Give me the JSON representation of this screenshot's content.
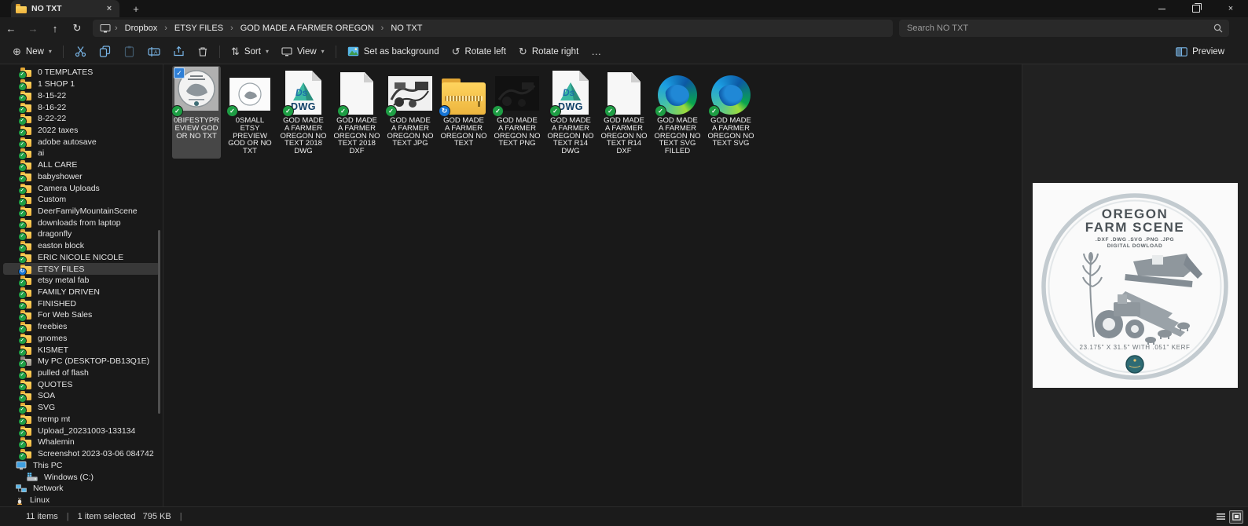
{
  "window": {
    "tab_title": "NO TXT"
  },
  "address": {
    "breadcrumbs": [
      "Dropbox",
      "ETSY FILES",
      "GOD MADE A FARMER OREGON",
      "NO TXT"
    ],
    "search_placeholder": "Search NO TXT"
  },
  "toolbar": {
    "new": "New",
    "sort": "Sort",
    "view": "View",
    "set_as_background": "Set as background",
    "rotate_left": "Rotate left",
    "rotate_right": "Rotate right",
    "more": "…",
    "preview": "Preview"
  },
  "icons": {
    "dwg_label": "DWG"
  },
  "sidebar": {
    "items": [
      {
        "label": "0 TEMPLATES",
        "icon": "dropbox"
      },
      {
        "label": "1 SHOP 1",
        "icon": "dropbox"
      },
      {
        "label": "8-15-22",
        "icon": "dropbox"
      },
      {
        "label": "8-16-22",
        "icon": "dropbox"
      },
      {
        "label": "8-22-22",
        "icon": "dropbox"
      },
      {
        "label": "2022 taxes",
        "icon": "dropbox"
      },
      {
        "label": "adobe autosave",
        "icon": "dropbox"
      },
      {
        "label": "ai",
        "icon": "dropbox"
      },
      {
        "label": "ALL CARE",
        "icon": "dropbox"
      },
      {
        "label": "babyshower",
        "icon": "dropbox"
      },
      {
        "label": "Camera Uploads",
        "icon": "dropbox"
      },
      {
        "label": "Custom",
        "icon": "dropbox"
      },
      {
        "label": "DeerFamilyMountainScene",
        "icon": "dropbox"
      },
      {
        "label": "downloads from laptop",
        "icon": "dropbox"
      },
      {
        "label": "dragonfly",
        "icon": "dropbox"
      },
      {
        "label": "easton block",
        "icon": "dropbox"
      },
      {
        "label": "ERIC NICOLE NICOLE",
        "icon": "dropbox"
      },
      {
        "label": "ETSY FILES",
        "icon": "dropbox-sync",
        "selected": true
      },
      {
        "label": "etsy metal fab",
        "icon": "dropbox"
      },
      {
        "label": "FAMILY DRIVEN",
        "icon": "dropbox"
      },
      {
        "label": "FINISHED",
        "icon": "dropbox"
      },
      {
        "label": "For Web Sales",
        "icon": "dropbox"
      },
      {
        "label": "freebies",
        "icon": "dropbox"
      },
      {
        "label": "gnomes",
        "icon": "dropbox"
      },
      {
        "label": "KISMET",
        "icon": "dropbox"
      },
      {
        "label": "My PC (DESKTOP-DB13Q1E)",
        "icon": "folder-gray"
      },
      {
        "label": "pulled of flash",
        "icon": "dropbox"
      },
      {
        "label": "QUOTES",
        "icon": "dropbox"
      },
      {
        "label": "SOA",
        "icon": "dropbox"
      },
      {
        "label": "SVG",
        "icon": "dropbox"
      },
      {
        "label": "tremp mt",
        "icon": "dropbox"
      },
      {
        "label": "Upload_20231003-133134",
        "icon": "dropbox"
      },
      {
        "label": "Whalemin",
        "icon": "dropbox"
      },
      {
        "label": "Screenshot 2023-03-06 084742",
        "icon": "dropbox"
      },
      {
        "label": "This PC",
        "icon": "pc",
        "indent": "root"
      },
      {
        "label": "Windows (C:)",
        "icon": "drive",
        "indent": "child"
      },
      {
        "label": "Network",
        "icon": "network",
        "indent": "root"
      },
      {
        "label": "Linux",
        "icon": "linux",
        "indent": "root"
      }
    ]
  },
  "files": [
    {
      "label": "0BIFESTYPREVIEW GOD OR NO TXT",
      "icon": "thumb-big",
      "badge": "check",
      "selected": true
    },
    {
      "label": "0SMALL ETSY PREVIEW GOD OR NO TXT",
      "icon": "thumb-small",
      "badge": "check"
    },
    {
      "label": "GOD MADE A FARMER OREGON NO TEXT 2018 DWG",
      "icon": "dwg",
      "badge": "check"
    },
    {
      "label": "GOD MADE A FARMER OREGON NO TEXT 2018 DXF",
      "icon": "dxf",
      "badge": "check"
    },
    {
      "label": "GOD MADE A FARMER OREGON NO TEXT JPG",
      "icon": "jpg",
      "badge": "check"
    },
    {
      "label": "GOD MADE A FARMER OREGON NO TEXT",
      "icon": "zip",
      "badge": "sync"
    },
    {
      "label": "GOD MADE A FARMER OREGON NO TEXT PNG",
      "icon": "png",
      "badge": "check"
    },
    {
      "label": "GOD MADE A FARMER OREGON NO TEXT R14 DWG",
      "icon": "dwg",
      "badge": "check"
    },
    {
      "label": "GOD MADE A FARMER OREGON NO TEXT R14 DXF",
      "icon": "dxf",
      "badge": "check"
    },
    {
      "label": "GOD MADE A FARMER OREGON NO TEXT SVG FILLED",
      "icon": "edge",
      "badge": "check"
    },
    {
      "label": "GOD MADE A FARMER OREGON NO TEXT SVG",
      "icon": "edge",
      "badge": "check"
    }
  ],
  "preview_pane": {
    "title_line1": "OREGON",
    "title_line2": "FARM SCENE",
    "formats": ".DXF .DWG .SVG .PNG .JPG",
    "subtitle": "DIGITAL DOWLOAD",
    "dimensions": "23.175\" X 31.5\" WITH .051\" KERF"
  },
  "statusbar": {
    "items_count": "11 items",
    "selection": "1 item selected",
    "size": "795 KB",
    "divider": "|"
  }
}
